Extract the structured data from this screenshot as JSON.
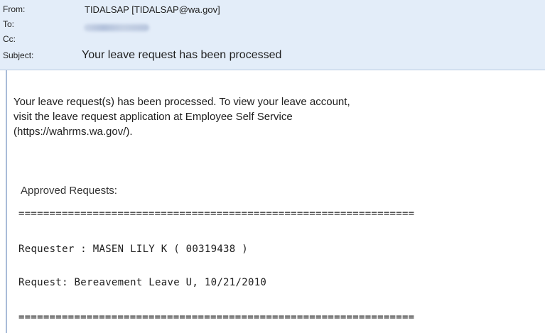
{
  "header": {
    "from_label": "From:",
    "from_value": "TIDALSAP [TIDALSAP@wa.gov]",
    "to_label": "To:",
    "cc_label": "Cc:",
    "subject_label": "Subject:",
    "subject_value": "Your leave request has been processed"
  },
  "message": {
    "line1": "Your leave request(s) has been processed.  To view your leave account,",
    "line2": "visit the leave request application at Employee Self Service",
    "line3": "(https://wahrms.wa.gov/).",
    "approved_heading": "Approved Requests:",
    "separator": "================================================================",
    "requester_line": "Requester : MASEN LILY K ( 00319438 )",
    "request_line": "Request: Bereavement Leave U, 10/21/2010",
    "separator_bottom": "================================================================"
  },
  "colors": {
    "header_bg": "#e3edf9",
    "body_border": "#a9bcd8"
  }
}
